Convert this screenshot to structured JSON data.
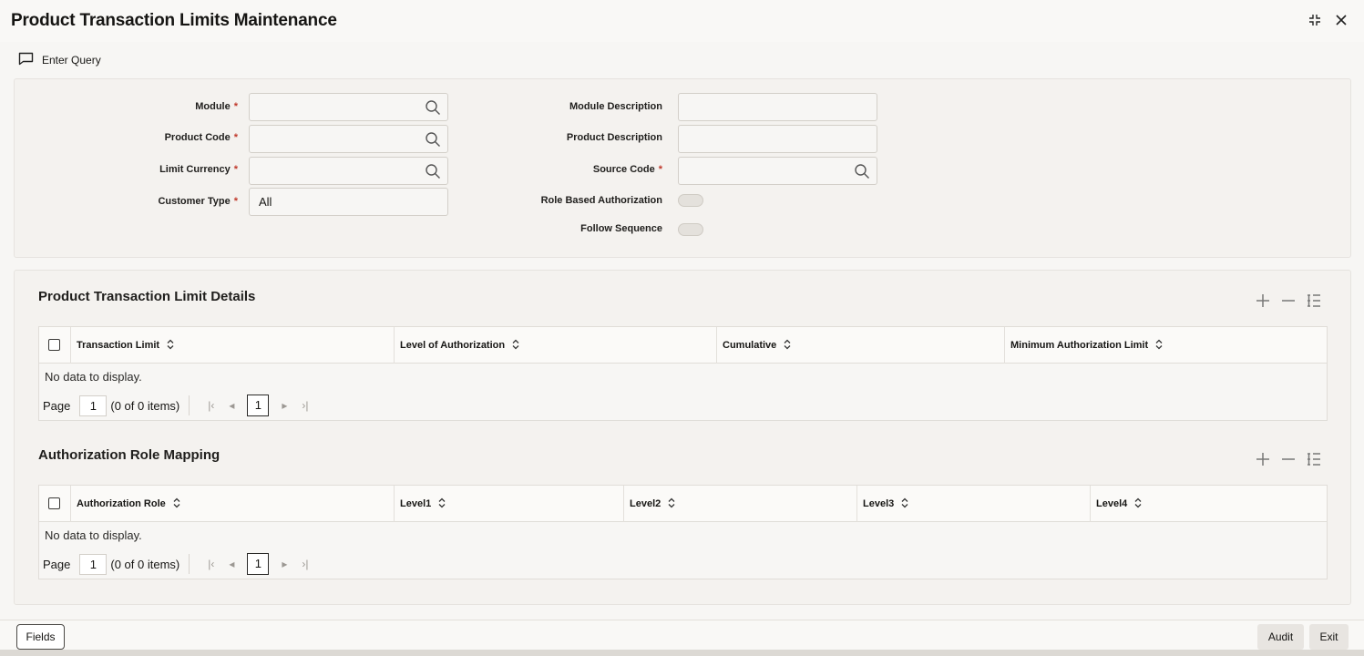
{
  "window": {
    "title": "Product Transaction Limits Maintenance"
  },
  "toolbar": {
    "enter_query_label": "Enter Query"
  },
  "form": {
    "module_label": "Module",
    "product_code_label": "Product Code",
    "limit_currency_label": "Limit Currency",
    "customer_type_label": "Customer Type",
    "customer_type_value": "All",
    "module_description_label": "Module Description",
    "product_description_label": "Product Description",
    "source_code_label": "Source Code",
    "role_based_authorization_label": "Role Based Authorization",
    "follow_sequence_label": "Follow Sequence",
    "required_marker": "*"
  },
  "limit_details": {
    "title": "Product Transaction Limit Details",
    "columns": [
      "Transaction Limit",
      "Level of Authorization",
      "Cumulative",
      "Minimum Authorization Limit"
    ],
    "empty_text": "No data to display.",
    "page_label": "Page",
    "page_value": "1",
    "items_text": "(0 of 0 items)",
    "current_page": "1"
  },
  "role_mapping": {
    "title": "Authorization Role Mapping",
    "columns": [
      "Authorization Role",
      "Level1",
      "Level2",
      "Level3",
      "Level4"
    ],
    "empty_text": "No data to display.",
    "page_label": "Page",
    "page_value": "1",
    "items_text": "(0 of 0 items)",
    "current_page": "1"
  },
  "footer": {
    "fields_label": "Fields",
    "audit_label": "Audit",
    "exit_label": "Exit"
  },
  "icons": {
    "collapse": "collapse-icon",
    "close": "close-icon",
    "enter_query": "chat-bubble-icon",
    "search": "search-icon",
    "sort": "sort-icon",
    "add": "plus-icon",
    "remove": "minus-icon",
    "columns": "list-settings-icon"
  }
}
